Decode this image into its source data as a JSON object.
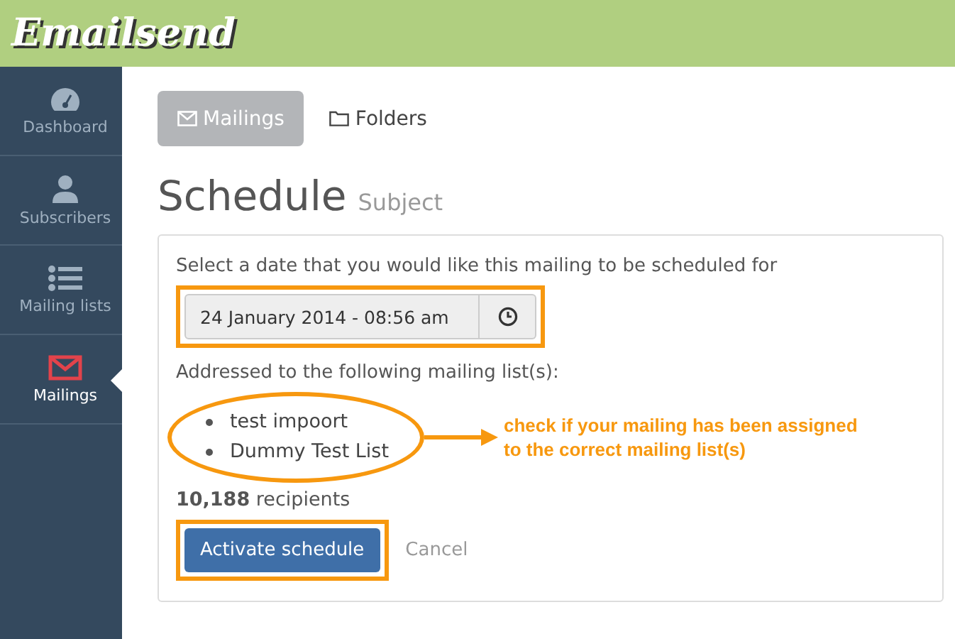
{
  "header": {
    "logo": "Emailsend"
  },
  "sidebar": {
    "items": [
      {
        "label": "Dashboard",
        "selected": false
      },
      {
        "label": "Subscribers",
        "selected": false
      },
      {
        "label": "Mailing lists",
        "selected": false
      },
      {
        "label": "Mailings",
        "selected": true
      }
    ]
  },
  "tabs": [
    {
      "label": "Mailings",
      "selected": true
    },
    {
      "label": "Folders",
      "selected": false
    }
  ],
  "page": {
    "title": "Schedule",
    "subtitle": "Subject"
  },
  "schedule": {
    "prompt": "Select a date that you would like this mailing to be scheduled for",
    "date_value": "24 January 2014 - 08:56 am",
    "lists_label": "Addressed to the following mailing list(s):",
    "lists": [
      "test impoort",
      "Dummy Test List"
    ],
    "recipients_count": "10,188",
    "recipients_label": "recipients",
    "activate_button": "Activate schedule",
    "cancel_link": "Cancel"
  },
  "annotation": {
    "text": "check if your mailing has been assigned to the correct mailing list(s)"
  }
}
